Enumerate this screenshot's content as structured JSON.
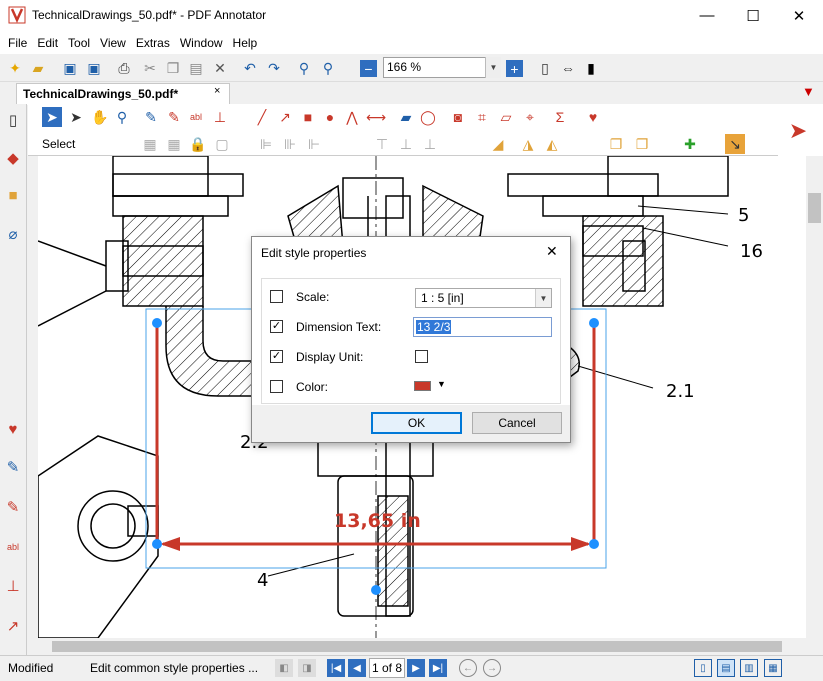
{
  "window": {
    "title": "TechnicalDrawings_50.pdf* - PDF Annotator",
    "minimize_icon": "minimize-icon",
    "maximize_icon": "maximize-icon",
    "close_icon": "close-icon"
  },
  "menu": {
    "items": [
      "File",
      "Edit",
      "Tool",
      "View",
      "Extras",
      "Window",
      "Help"
    ]
  },
  "toolbar": {
    "zoom_value": "166 %"
  },
  "tabs": {
    "active_label": "TechnicalDrawings_50.pdf*",
    "close_glyph": "×"
  },
  "annotation_toolbar": {
    "select_label": "Select"
  },
  "drawing": {
    "dimension_label": "13,65 in",
    "callouts": [
      "5",
      "16",
      "2.1",
      "2.2",
      "4"
    ],
    "accent_color": "#c8382a",
    "handle_color": "#1e90ff"
  },
  "dialog": {
    "title": "Edit style properties",
    "rows": [
      {
        "label": "Scale:",
        "checked": false,
        "value": "1 : 5 [in]"
      },
      {
        "label": "Dimension Text:",
        "checked": true,
        "value": "13 2/3"
      },
      {
        "label": "Display Unit:",
        "checked": true,
        "value_checked": false
      },
      {
        "label": "Color:",
        "checked": false,
        "value": "#c8382a"
      }
    ],
    "ok_label": "OK",
    "cancel_label": "Cancel"
  },
  "status": {
    "state": "Modified",
    "hint": "Edit common style properties ...",
    "page_indicator": "1 of 8"
  }
}
